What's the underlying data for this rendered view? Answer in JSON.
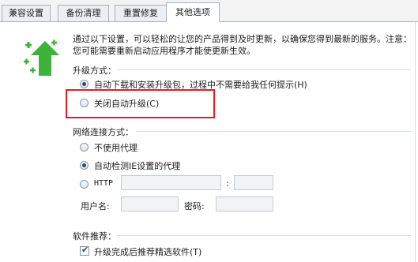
{
  "tabs": [
    {
      "label": "兼容设置"
    },
    {
      "label": "备份清理"
    },
    {
      "label": "重置修复"
    },
    {
      "label": "其他选项"
    }
  ],
  "description_lines": [
    "通过以下设置，可以轻松的让您的产品得到及时更新，以确保您得到最新的服务。注意：",
    "您可能需要重新启动应用程序才能使更新生效。"
  ],
  "upgrade": {
    "title": "升级方式：",
    "options": [
      {
        "label": "自动下载和安装升级包，过程中不需要给我任何提示(H)",
        "selected": true
      },
      {
        "label": "关闭自动升级(C)",
        "selected": false
      }
    ]
  },
  "network": {
    "title": "网络连接方式：",
    "options": [
      {
        "label": "不使用代理",
        "selected": false
      },
      {
        "label": "自动检测IE设置的代理",
        "selected": true
      },
      {
        "label": "HTTP",
        "selected": false
      }
    ],
    "port_separator": ":",
    "username_label": "用户名:",
    "password_label": "密码:",
    "host_value": "",
    "port_value": "",
    "username_value": "",
    "password_value": ""
  },
  "software": {
    "title": "软件推荐：",
    "checkbox_label": "升级完成后推荐精选软件(T)",
    "checked": true
  },
  "colors": {
    "logo_arrow": "#3db33a",
    "logo_sparkle": "#3db33a",
    "highlight_border": "#e01f1f"
  },
  "icons": {
    "logo": "green-up-arrow-upgrade-icon",
    "checkbox_tick": "check-icon"
  }
}
